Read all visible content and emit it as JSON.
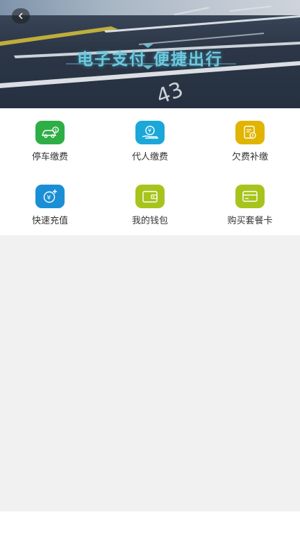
{
  "banner": {
    "title": "电子支付 便捷出行",
    "back_icon": "chevron-left-icon"
  },
  "menu": [
    {
      "label": "停车缴费",
      "icon": "car-coin-icon",
      "color": "#2fae46"
    },
    {
      "label": "代人缴费",
      "icon": "hand-yen-icon",
      "color": "#1ba7d8"
    },
    {
      "label": "欠费补缴",
      "icon": "bill-icon",
      "color": "#e0b400"
    },
    {
      "label": "快速充值",
      "icon": "recharge-icon",
      "color": "#1b8fd6"
    },
    {
      "label": "我的钱包",
      "icon": "wallet-icon",
      "color": "#a7c41c"
    },
    {
      "label": "购买套餐卡",
      "icon": "card-icon",
      "color": "#a7c41c"
    }
  ]
}
